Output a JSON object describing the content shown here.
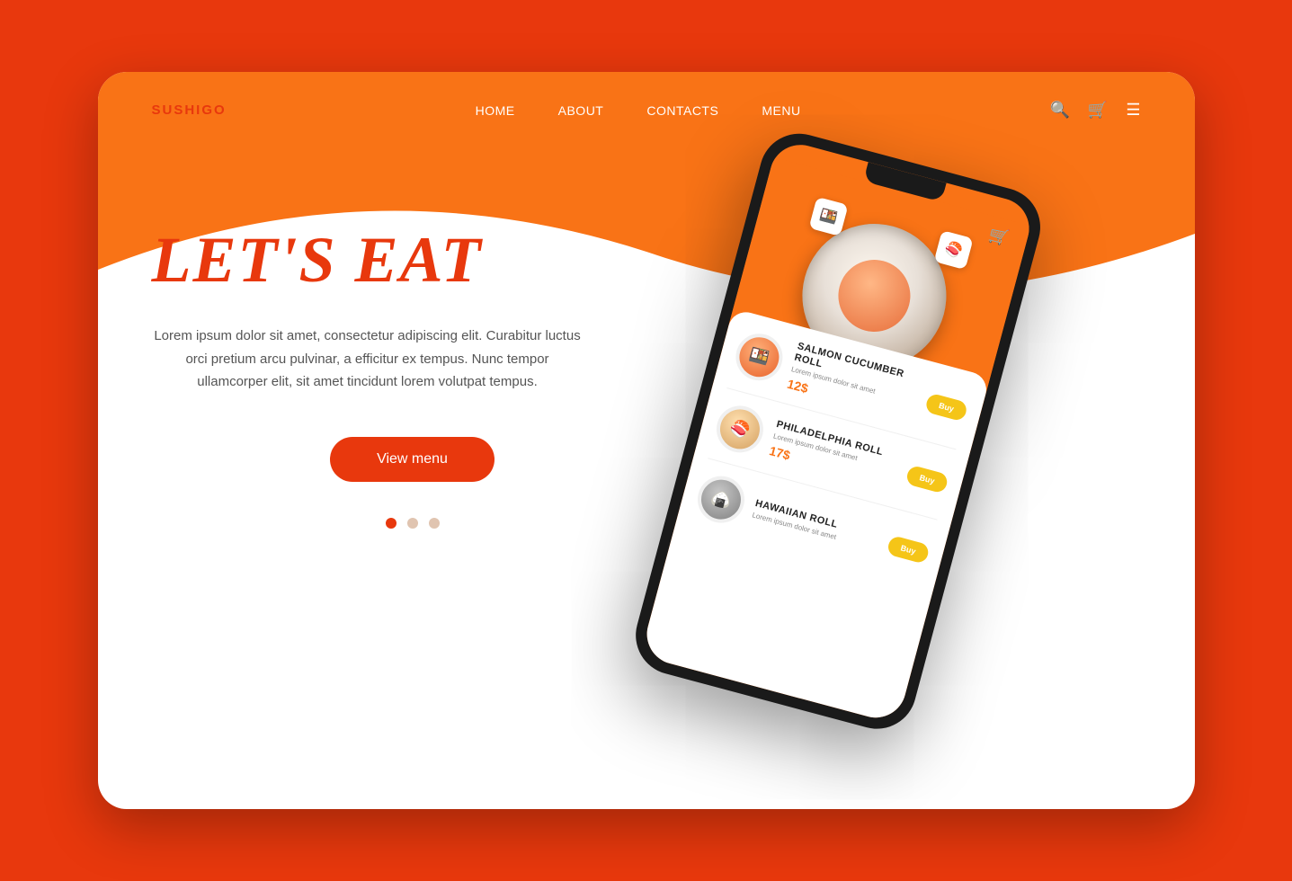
{
  "page": {
    "background_color": "#e8380d",
    "card_bg": "#ffffff"
  },
  "header": {
    "logo": "SUSHIGO",
    "nav_items": [
      {
        "label": "HOME",
        "active": false
      },
      {
        "label": "ABOUT",
        "active": false
      },
      {
        "label": "CONTACTS",
        "active": false
      },
      {
        "label": "MENU",
        "active": false
      }
    ],
    "icons": [
      "search",
      "cart",
      "menu"
    ]
  },
  "hero": {
    "title": "LET'S EAT",
    "description": "Lorem ipsum dolor sit amet, consectetur adipiscing elit. Curabitur luctus orci pretium arcu pulvinar, a efficitur ex tempus. Nunc tempor ullamcorper elit, sit amet tincidunt lorem volutpat tempus.",
    "cta_label": "View menu",
    "dots": [
      {
        "active": true
      },
      {
        "active": false
      },
      {
        "active": false
      }
    ]
  },
  "phone": {
    "menu_items": [
      {
        "name": "SALMON CUCUMBER ROLL",
        "description": "Lorem ipsum dolor sit amet",
        "price": "12$",
        "buy_label": "Buy"
      },
      {
        "name": "PHILADELPHIA ROLL",
        "description": "Lorem ipsum dolor sit amet",
        "price": "17$",
        "buy_label": "Buy"
      },
      {
        "name": "HAWAIIAN ROLL",
        "description": "Lorem ipsum dolor sit amet",
        "price": "",
        "buy_label": "Buy"
      }
    ]
  }
}
